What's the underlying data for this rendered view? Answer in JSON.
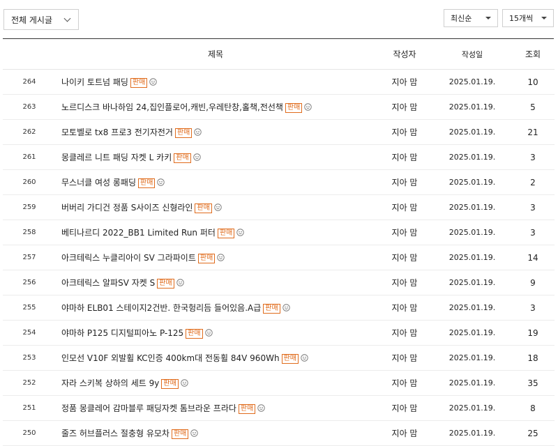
{
  "filter": {
    "label": "전체 게시글"
  },
  "sort": {
    "selected": "최신순"
  },
  "count": {
    "selected": "15개씩"
  },
  "table": {
    "headers": {
      "title": "제목",
      "author": "작성자",
      "date": "작성일",
      "views": "조회"
    },
    "sale_badge": "판매",
    "rows": [
      {
        "num": "264",
        "title": "나이키 토트넘 패딩",
        "author": "지아 맘",
        "date": "2025.01.19.",
        "views": "10"
      },
      {
        "num": "263",
        "title": "노르디스크 바나하임 24,집인플로어,캐빈,우레탄창,홀책,전선책",
        "author": "지아 맘",
        "date": "2025.01.19.",
        "views": "5"
      },
      {
        "num": "262",
        "title": "모토벨로 tx8 프로3 전기자전거",
        "author": "지아 맘",
        "date": "2025.01.19.",
        "views": "21"
      },
      {
        "num": "261",
        "title": "몽클레르 니트 패딩 자켓 L 카키",
        "author": "지아 맘",
        "date": "2025.01.19.",
        "views": "3"
      },
      {
        "num": "260",
        "title": "무스너클 여성 롱패딩",
        "author": "지아 맘",
        "date": "2025.01.19.",
        "views": "2"
      },
      {
        "num": "259",
        "title": "버버리 가디건 정품 S사이즈 신형라인",
        "author": "지아 맘",
        "date": "2025.01.19.",
        "views": "3"
      },
      {
        "num": "258",
        "title": "베티나르디 2022_BB1 Limited Run 퍼터",
        "author": "지아 맘",
        "date": "2025.01.19.",
        "views": "3"
      },
      {
        "num": "257",
        "title": "아크테릭스 누클리아이 SV 그라파이트",
        "author": "지아 맘",
        "date": "2025.01.19.",
        "views": "14"
      },
      {
        "num": "256",
        "title": "아크테릭스 알파SV 자켓 S",
        "author": "지아 맘",
        "date": "2025.01.19.",
        "views": "9"
      },
      {
        "num": "255",
        "title": "야마하 ELB01 스테이지2건반. 한국헝리듬 들어있음.A급",
        "author": "지아 맘",
        "date": "2025.01.19.",
        "views": "3"
      },
      {
        "num": "254",
        "title": "야마하 P125 디지털피아노 P-125",
        "author": "지아 맘",
        "date": "2025.01.19.",
        "views": "19"
      },
      {
        "num": "253",
        "title": "인모선 V10F 외발휠 KC인증 400km대 전동휠 84V 960Wh",
        "author": "지아 맘",
        "date": "2025.01.19.",
        "views": "18"
      },
      {
        "num": "252",
        "title": "자라 스키복 상하의 세트 9y",
        "author": "지아 맘",
        "date": "2025.01.19.",
        "views": "35"
      },
      {
        "num": "251",
        "title": "정품 몽클레어 감마블루 패딩자켓 톰브라운 프라다",
        "author": "지아 맘",
        "date": "2025.01.19.",
        "views": "8"
      },
      {
        "num": "250",
        "title": "줄즈 허브플러스 절충형 유모차",
        "author": "지아 맘",
        "date": "2025.01.19.",
        "views": "25"
      }
    ]
  }
}
